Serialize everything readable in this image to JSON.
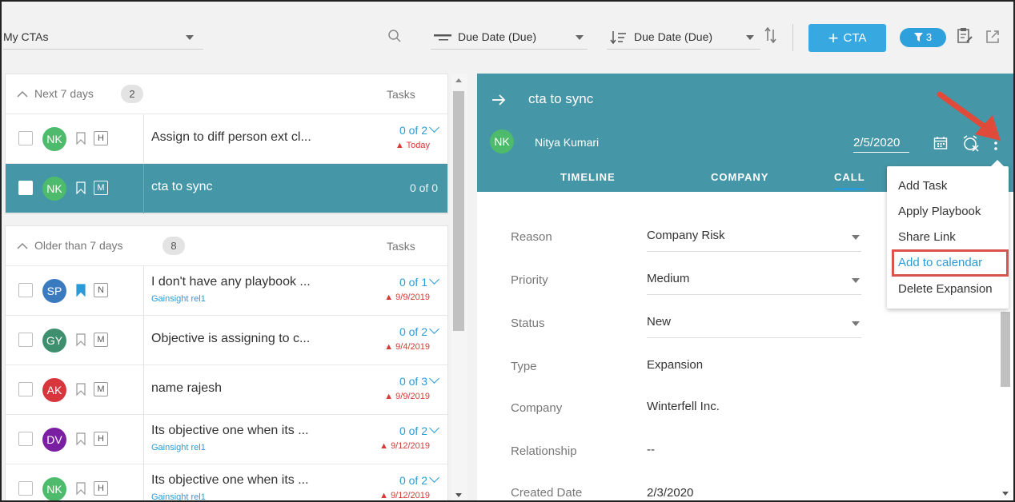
{
  "toolbar": {
    "view": "My CTAs",
    "sort1": "Due Date (Due)",
    "sort2": "Due Date (Due)",
    "cta_label": "CTA",
    "filter_count": "3"
  },
  "list": {
    "groups": [
      {
        "title": "Next 7 days",
        "count": "2",
        "tasks_header": "Tasks",
        "rows": [
          {
            "initials": "NK",
            "avatar_color": "#4dbb6b",
            "priority": "H",
            "name": "Assign to diff person ext cl...",
            "sub": "",
            "tasks": "0 of 2",
            "due": "Today",
            "bookmarked": false,
            "selected": false
          },
          {
            "initials": "NK",
            "avatar_color": "#4dbb6b",
            "priority": "M",
            "name": "cta to sync",
            "sub": "",
            "tasks": "0 of 0",
            "due": "",
            "bookmarked": false,
            "selected": true
          }
        ]
      },
      {
        "title": "Older than 7 days",
        "count": "8",
        "tasks_header": "Tasks",
        "rows": [
          {
            "initials": "SP",
            "avatar_color": "#3a7bbf",
            "priority": "N",
            "name": "I don't have any playbook ...",
            "sub": "Gainsight rel1",
            "tasks": "0 of 1",
            "due": "9/9/2019",
            "bookmarked": true,
            "selected": false
          },
          {
            "initials": "GY",
            "avatar_color": "#3e8f6e",
            "priority": "M",
            "name": "Objective is assigning to c...",
            "sub": "",
            "tasks": "0 of 2",
            "due": "9/4/2019",
            "bookmarked": false,
            "selected": false
          },
          {
            "initials": "AK",
            "avatar_color": "#d7363d",
            "priority": "M",
            "name": "name rajesh",
            "sub": "",
            "tasks": "0 of 3",
            "due": "9/9/2019",
            "bookmarked": false,
            "selected": false
          },
          {
            "initials": "DV",
            "avatar_color": "#7a1fa2",
            "priority": "H",
            "name": "Its objective one when its ...",
            "sub": "Gainsight rel1",
            "tasks": "0 of 2",
            "due": "9/12/2019",
            "bookmarked": false,
            "selected": false
          },
          {
            "initials": "NK",
            "avatar_color": "#4dbb6b",
            "priority": "H",
            "name": "Its objective one when its ...",
            "sub": "Gainsight rel1",
            "tasks": "0 of 2",
            "due": "9/12/2019",
            "bookmarked": false,
            "selected": false
          }
        ]
      }
    ]
  },
  "detail": {
    "title": "cta to sync",
    "owner_initials": "NK",
    "owner": "Nitya Kumari",
    "date": "2/5/2020",
    "tabs": [
      "TIMELINE",
      "COMPANY",
      "CALL"
    ],
    "fields": [
      {
        "label": "Reason",
        "value": "Company Risk",
        "dropdown": true
      },
      {
        "label": "Priority",
        "value": "Medium",
        "dropdown": true
      },
      {
        "label": "Status",
        "value": "New",
        "dropdown": true
      },
      {
        "label": "Type",
        "value": "Expansion",
        "dropdown": false
      },
      {
        "label": "Company",
        "value": "Winterfell Inc.",
        "dropdown": false
      },
      {
        "label": "Relationship",
        "value": "--",
        "dropdown": false
      },
      {
        "label": "Created Date",
        "value": "2/3/2020",
        "dropdown": false
      }
    ]
  },
  "menu": {
    "items": [
      "Add Task",
      "Apply Playbook",
      "Share Link",
      "Add to calendar",
      "Delete Expansion"
    ],
    "highlighted": "Add to calendar"
  },
  "colors": {
    "header_teal": "#4596a6",
    "accent_blue": "#2b9bd7",
    "cta_button": "#38a8e0",
    "overdue_red": "#d83a34",
    "annotation_red": "#e04a3b"
  }
}
